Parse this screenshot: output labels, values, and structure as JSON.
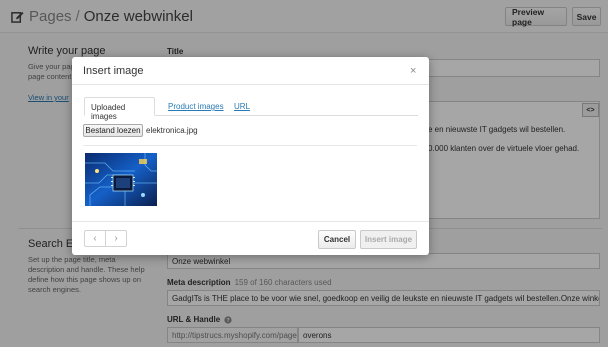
{
  "header": {
    "breadcrumb_root": "Pages",
    "breadcrumb_separator": "/",
    "page_name": "Onze webwinkel",
    "preview_label": "Preview page",
    "save_label": "Save"
  },
  "write_section": {
    "title": "Write your page",
    "description_line1": "Give your page a",
    "description_line2": "page content",
    "view_link": "View in your"
  },
  "title_field": {
    "label": "Title"
  },
  "editor": {
    "line1": "e en nieuwste IT gadgets wil bestellen.",
    "line2": "0.000 klanten over de virtuele vloer gehad.",
    "code_button": "<>"
  },
  "seo_section": {
    "title": "Search E",
    "description_line1": "Set up the page title, meta",
    "description_line2": "description and handle. These help",
    "description_line3": "define how this page shows up on",
    "description_line4": "search engines.",
    "page_title_value": "Onze webwinkel",
    "meta_label": "Meta description",
    "meta_hint": "159 of 160 characters used",
    "meta_value": "GadgITs is THE place to be voor wie snel, goedkoop en veilig de leukste en nieuwste IT gadgets wil bestellen.Onze winkel is door",
    "url_label": "URL & Handle",
    "url_prefix": "http://tipstrucs.myshopify.com/pages/",
    "handle_value": "overons"
  },
  "modal": {
    "title": "Insert image",
    "close": "×",
    "tabs": [
      {
        "label": "Uploaded images"
      },
      {
        "label": "Product images"
      },
      {
        "label": "URL"
      }
    ],
    "file_button": "Bestand loezen",
    "file_name": "elektronica.jpg",
    "pager_prev": "‹",
    "pager_next": "›",
    "cancel_label": "Cancel",
    "insert_label": "Insert image"
  },
  "colors": {
    "link": "#2a7ab5",
    "overlay": "rgba(0,0,0,0.35)"
  }
}
